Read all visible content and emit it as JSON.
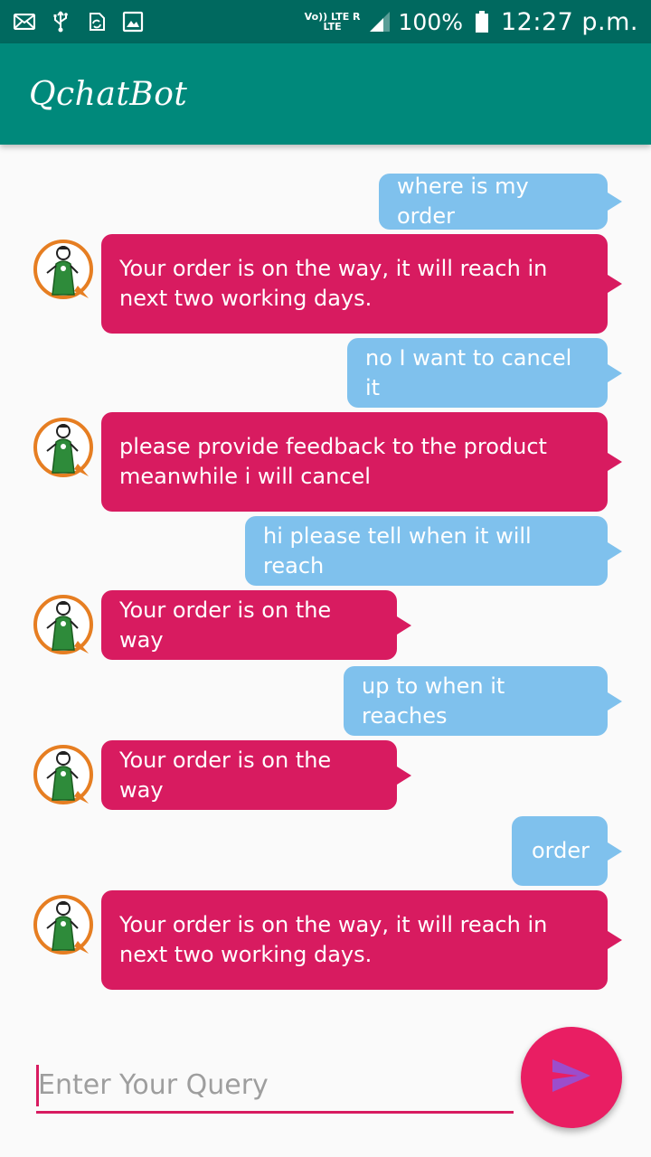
{
  "status_bar": {
    "net_top": "Vo)) LTE R",
    "net_bottom": "LTE",
    "battery": "100%",
    "time": "12:27 p.m.",
    "icons": [
      "mail-icon",
      "usb-icon",
      "sync-icon",
      "image-icon",
      "signal-icon",
      "battery-icon"
    ]
  },
  "app_bar": {
    "title": "QchatBot"
  },
  "messages": [
    {
      "from": "user",
      "text": "where is my order"
    },
    {
      "from": "bot",
      "text": "Your order is on the way, it will reach in next two working days."
    },
    {
      "from": "user",
      "text": "no I want to cancel it"
    },
    {
      "from": "bot",
      "text": "please provide feedback to the product meanwhile i will cancel"
    },
    {
      "from": "user",
      "text": "hi please tell when it will reach"
    },
    {
      "from": "bot",
      "text": "Your order is on the way"
    },
    {
      "from": "user",
      "text": "up to when it reaches"
    },
    {
      "from": "bot",
      "text": "Your order is on the way"
    },
    {
      "from": "user",
      "text": "order"
    },
    {
      "from": "bot",
      "text": "Your order is on the way, it will reach in next two working days."
    }
  ],
  "input": {
    "placeholder": "Enter Your Query",
    "value": ""
  },
  "send_button": {
    "icon": "send-icon"
  },
  "colors": {
    "status_bar": "#00695f",
    "app_bar": "#00897b",
    "user_bubble": "#7fc1ed",
    "bot_bubble": "#d81b60",
    "accent": "#e91e63",
    "send_arrow": "#9c4dcc"
  }
}
